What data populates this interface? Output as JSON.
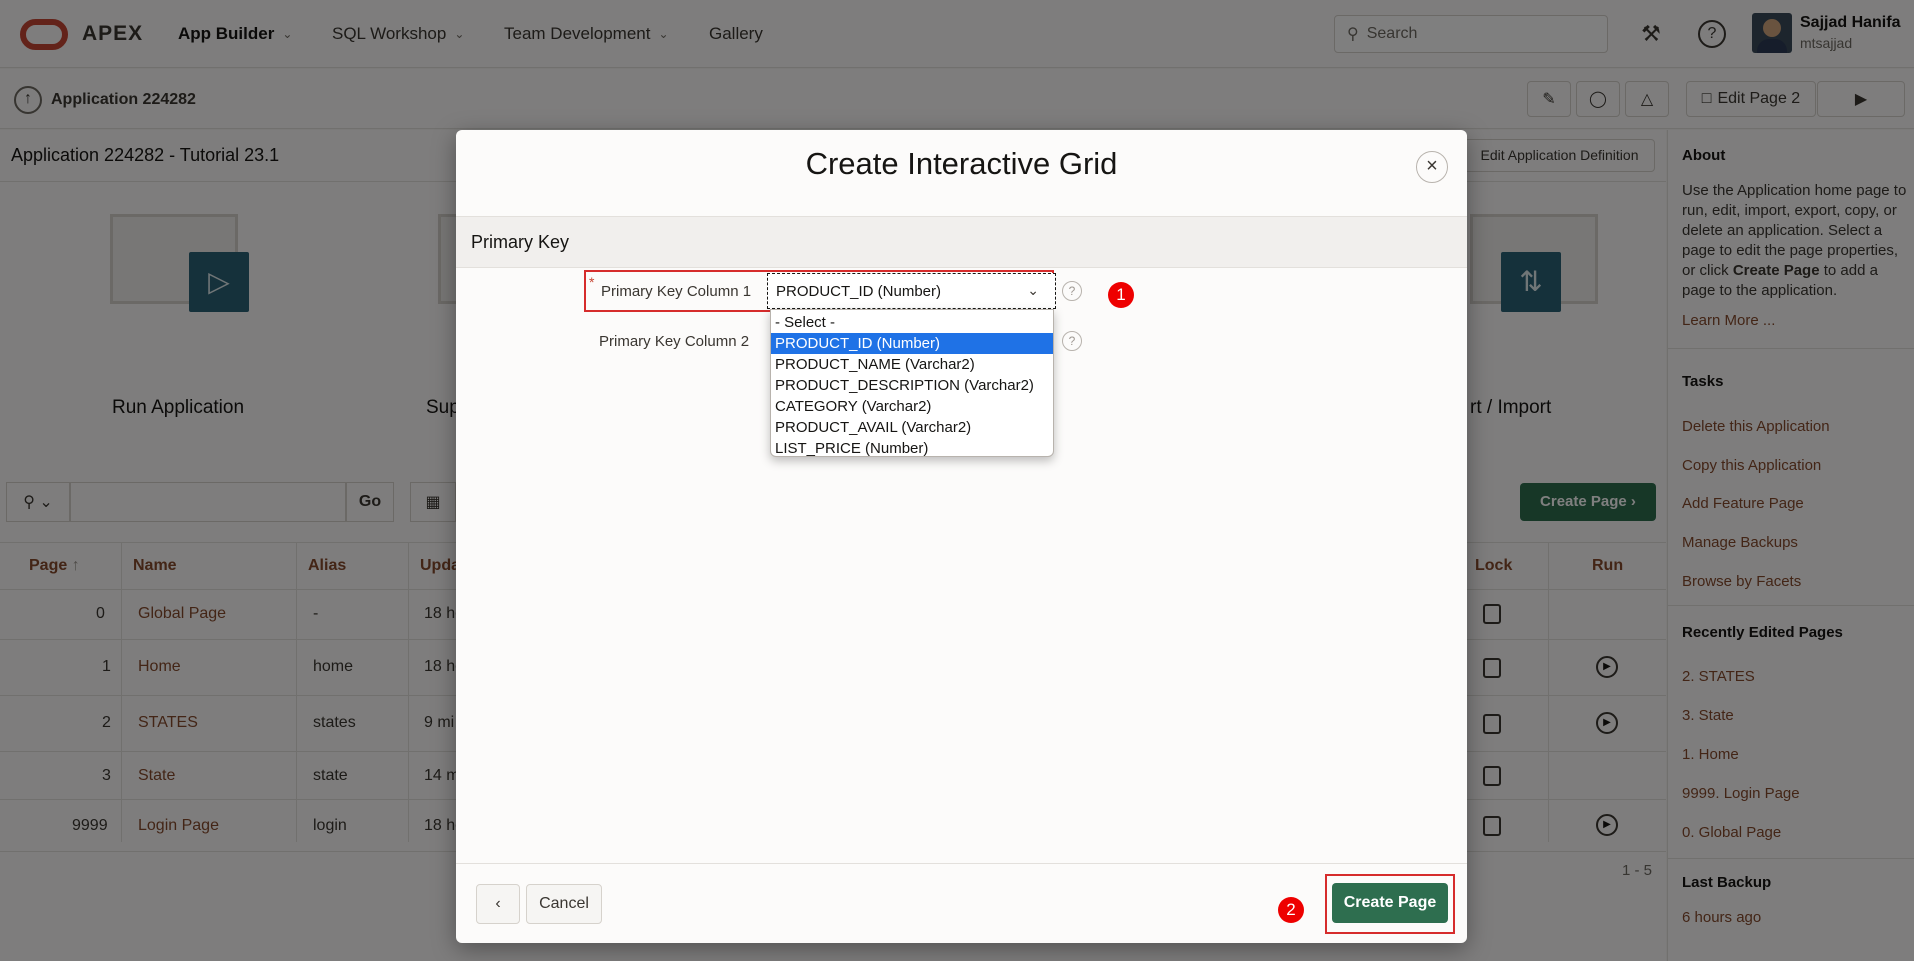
{
  "topbar": {
    "brand": "APEX",
    "nav": [
      {
        "label": "App Builder",
        "has_menu": true
      },
      {
        "label": "SQL Workshop",
        "has_menu": true
      },
      {
        "label": "Team Development",
        "has_menu": true
      },
      {
        "label": "Gallery",
        "has_menu": false
      }
    ],
    "search_placeholder": "Search",
    "user_name": "Sajjad Hanifa",
    "user_login": "mtsajjad"
  },
  "subbar": {
    "app_label": "Application 224282",
    "edit_page_label": "Edit Page 2"
  },
  "page": {
    "title": "Application 224282 - Tutorial 23.1",
    "edit_def_label": "Edit Application Definition",
    "tiles": [
      {
        "label": "Run Application"
      },
      {
        "label": "Sup"
      },
      {
        "label": "rt / Import"
      }
    ],
    "go_label": "Go",
    "create_page_label": "Create Page",
    "table": {
      "columns": [
        "Page",
        "Name",
        "Alias",
        "Upda",
        "Lock",
        "Run"
      ],
      "rows": [
        {
          "page": "0",
          "name": "Global Page",
          "alias": "-",
          "updated": "18 ho",
          "run": false
        },
        {
          "page": "1",
          "name": "Home",
          "alias": "home",
          "updated": "18 ho",
          "run": true
        },
        {
          "page": "2",
          "name": "STATES",
          "alias": "states",
          "updated": "9 mi",
          "run": true
        },
        {
          "page": "3",
          "name": "State",
          "alias": "state",
          "updated": "14 m",
          "run": false
        },
        {
          "page": "9999",
          "name": "Login Page",
          "alias": "login",
          "updated": "18 ho",
          "run": true
        }
      ],
      "pager": "1 - 5"
    }
  },
  "sidebar": {
    "about_title": "About",
    "about_text_1": "Use the Application home page to run, edit, import, export, copy, or delete an application. Select a page to edit the page properties, or click",
    "about_text_bold": "Create Page",
    "about_text_2": "to add a page to the application.",
    "learn_more": "Learn More ...",
    "tasks_title": "Tasks",
    "tasks": [
      "Delete this Application",
      "Copy this Application",
      "Add Feature Page",
      "Manage Backups",
      "Browse by Facets"
    ],
    "recent_title": "Recently Edited Pages",
    "recent": [
      "2. STATES",
      "3. State",
      "1. Home",
      "9999. Login Page",
      "0. Global Page"
    ],
    "backup_title": "Last Backup",
    "backup_value": "6 hours ago"
  },
  "dialog": {
    "title": "Create Interactive Grid",
    "region_title": "Primary Key",
    "pk1_label": "Primary Key Column 1",
    "pk1_value": "PRODUCT_ID (Number)",
    "pk2_label": "Primary Key Column 2",
    "options": [
      "- Select -",
      "PRODUCT_ID (Number)",
      "PRODUCT_NAME (Varchar2)",
      "PRODUCT_DESCRIPTION (Varchar2)",
      "CATEGORY (Varchar2)",
      "PRODUCT_AVAIL (Varchar2)",
      "LIST_PRICE (Number)"
    ],
    "selected_index": 1,
    "cancel_label": "Cancel",
    "create_label": "Create Page",
    "badge_1": "1",
    "badge_2": "2"
  },
  "colors": {
    "accent_green": "#2e6e4f",
    "link_brown": "#874a2d",
    "annotation_red": "#e00000",
    "select_blue": "#1f72e6"
  }
}
